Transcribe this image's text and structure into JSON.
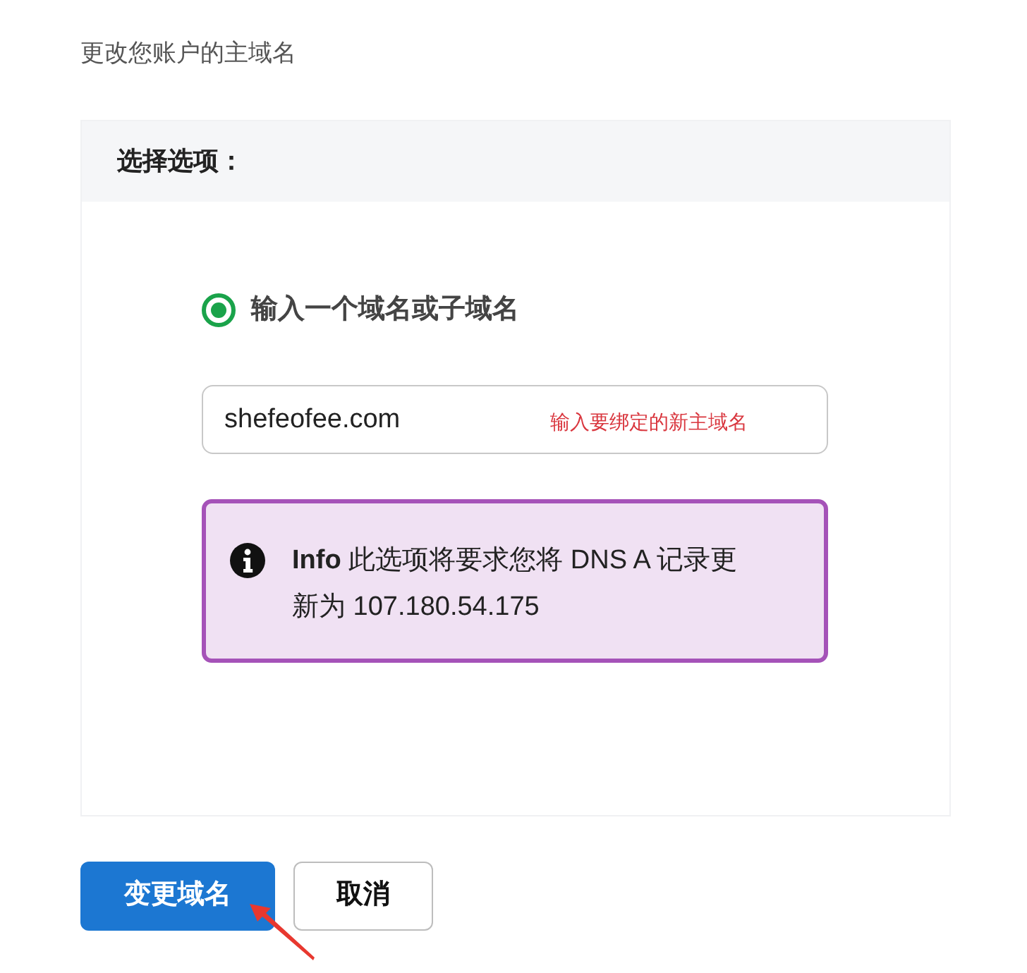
{
  "page": {
    "subtitle": "更改您账户的主域名"
  },
  "card": {
    "header": "选择选项：",
    "option": {
      "label": "输入一个域名或子域名",
      "selected": true
    },
    "domain_field": {
      "value": "shefeofee.com",
      "annotation": "输入要绑定的新主域名"
    },
    "info": {
      "text": "**Info** 此选项将要求您将 DNS A 记录更新为 107.180.54.175"
    }
  },
  "buttons": [
    {
      "label": "变更域名",
      "kind": "primary"
    },
    {
      "label": "取消",
      "kind": "secondary"
    }
  ]
}
